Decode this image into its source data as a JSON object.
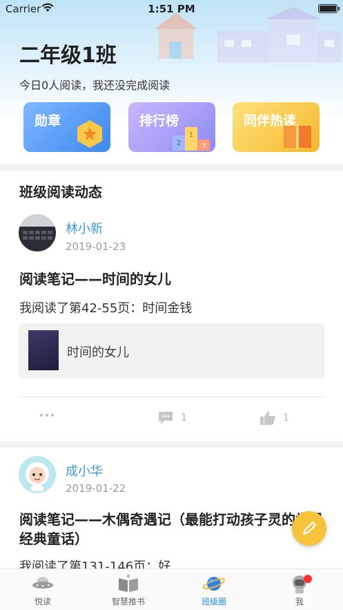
{
  "status_bar": {
    "carrier": "Carrier",
    "time": "1:51 PM"
  },
  "header": {
    "class_name": "二年级1班",
    "today_summary": "今日0人阅读，我还没完成阅读",
    "cards": [
      {
        "label": "勋章",
        "icon": "medal-icon",
        "color": "#3d87f0"
      },
      {
        "label": "排行榜",
        "icon": "podium-icon",
        "color": "#8e8bf0"
      },
      {
        "label": "同伴热读",
        "icon": "book-icon",
        "color": "#f5b72d"
      }
    ]
  },
  "feed": {
    "title": "班级阅读动态",
    "posts": [
      {
        "user": "林小新",
        "date": "2019-01-23",
        "title": "阅读笔记——时间的女儿",
        "body": "我阅读了第42-55页：时间金钱",
        "book": "时间的女儿",
        "comments": "1",
        "likes": "1"
      },
      {
        "user": "成小华",
        "date": "2019-01-22",
        "title": "阅读笔记——木偶奇遇记（最能打动孩子灵的世界经典童话）",
        "body": "我阅读了第131-146页：好"
      }
    ]
  },
  "tabs": [
    {
      "label": "悦读",
      "icon": "ufo-icon"
    },
    {
      "label": "智慧推书",
      "icon": "open-book-icon"
    },
    {
      "label": "班级圈",
      "icon": "planet-icon",
      "active": true
    },
    {
      "label": "我",
      "icon": "astronaut-icon",
      "badge": true
    }
  ],
  "colors": {
    "accent": "#1e88e5",
    "name": "#3a9ad9",
    "fab": "#f7c33a"
  }
}
